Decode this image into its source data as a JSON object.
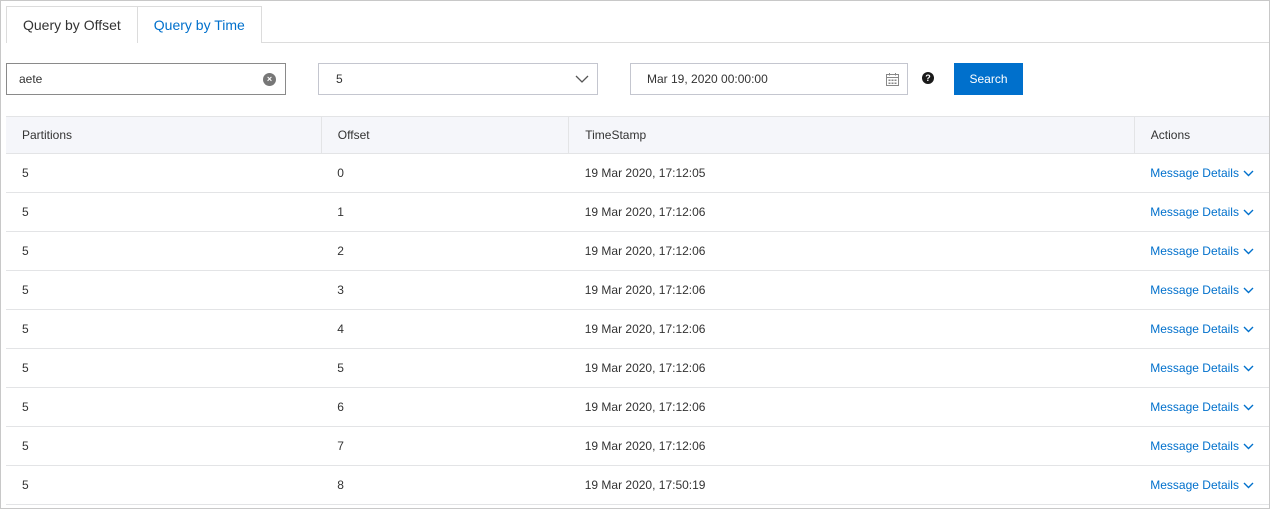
{
  "tabs": [
    {
      "label": "Query by Offset",
      "active": false
    },
    {
      "label": "Query by Time",
      "active": true
    }
  ],
  "filters": {
    "topic_value": "aete",
    "partition_value": "5",
    "datetime_value": "Mar 19, 2020 00:00:00",
    "search_label": "Search"
  },
  "colors": {
    "accent": "#0070cc"
  },
  "table": {
    "headers": [
      "Partitions",
      "Offset",
      "TimeStamp",
      "Actions"
    ],
    "action_label": "Message Details",
    "rows": [
      {
        "partition": "5",
        "offset": "0",
        "timestamp": "19 Mar 2020, 17:12:05"
      },
      {
        "partition": "5",
        "offset": "1",
        "timestamp": "19 Mar 2020, 17:12:06"
      },
      {
        "partition": "5",
        "offset": "2",
        "timestamp": "19 Mar 2020, 17:12:06"
      },
      {
        "partition": "5",
        "offset": "3",
        "timestamp": "19 Mar 2020, 17:12:06"
      },
      {
        "partition": "5",
        "offset": "4",
        "timestamp": "19 Mar 2020, 17:12:06"
      },
      {
        "partition": "5",
        "offset": "5",
        "timestamp": "19 Mar 2020, 17:12:06"
      },
      {
        "partition": "5",
        "offset": "6",
        "timestamp": "19 Mar 2020, 17:12:06"
      },
      {
        "partition": "5",
        "offset": "7",
        "timestamp": "19 Mar 2020, 17:12:06"
      },
      {
        "partition": "5",
        "offset": "8",
        "timestamp": "19 Mar 2020, 17:50:19"
      }
    ]
  }
}
